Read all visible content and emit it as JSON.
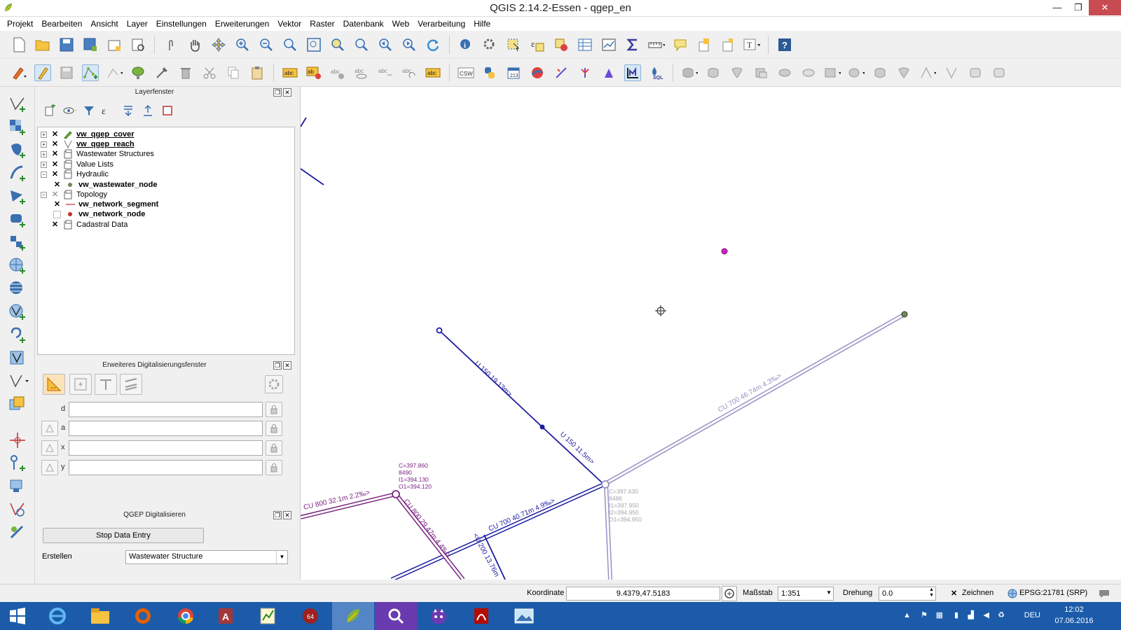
{
  "window": {
    "title": "QGIS 2.14.2-Essen - qgep_en",
    "minimize": "—",
    "restore": "❐",
    "close": "✕"
  },
  "menu": [
    "Projekt",
    "Bearbeiten",
    "Ansicht",
    "Layer",
    "Einstellungen",
    "Erweiterungen",
    "Vektor",
    "Raster",
    "Datenbank",
    "Web",
    "Verarbeitung",
    "Hilfe"
  ],
  "layers_panel": {
    "title": "Layerfenster",
    "layers": [
      {
        "name": "vw_qgep_cover",
        "checked": true,
        "expandable": true,
        "expanded": false,
        "bold": true,
        "icon": "pencil-icon"
      },
      {
        "name": "vw_qgep_reach",
        "checked": true,
        "expandable": true,
        "expanded": false,
        "bold": true,
        "icon": "line-icon"
      },
      {
        "name": "Wastewater Structures",
        "checked": true,
        "expandable": true,
        "expanded": false,
        "bold": false,
        "icon": "group-icon"
      },
      {
        "name": "Value Lists",
        "checked": true,
        "expandable": true,
        "expanded": false,
        "bold": false,
        "icon": "group-icon"
      },
      {
        "name": "Hydraulic",
        "checked": true,
        "expandable": true,
        "expanded": true,
        "bold": false,
        "icon": "group-icon"
      },
      {
        "name": "vw_wastewater_node",
        "checked": true,
        "expandable": false,
        "bold": true,
        "icon": "point-icon"
      },
      {
        "name": "Topology",
        "checked": "partial",
        "expandable": true,
        "expanded": true,
        "bold": false,
        "icon": "group-icon"
      },
      {
        "name": "vw_network_segment",
        "checked": true,
        "expandable": false,
        "bold": true,
        "icon": "red-line-icon"
      },
      {
        "name": "vw_network_node",
        "checked": false,
        "expandable": false,
        "bold": true,
        "icon": "red-point-icon"
      },
      {
        "name": "Cadastral Data",
        "checked": true,
        "expandable": false,
        "bold": false,
        "icon": "group-icon"
      }
    ]
  },
  "digitizing_panel": {
    "title": "Erweiteres Digitalisierungsfenster",
    "fields": [
      {
        "label": "d",
        "value": ""
      },
      {
        "label": "a",
        "value": ""
      },
      {
        "label": "x",
        "value": ""
      },
      {
        "label": "y",
        "value": ""
      }
    ]
  },
  "qgep_panel": {
    "title": "QGEP Digitalisieren",
    "stop_button": "Stop Data Entry",
    "create_label": "Erstellen",
    "create_value": "Wastewater Structure"
  },
  "map": {
    "labels": {
      "u150a": "U 150 19.13m>",
      "u150b": "U 150 11.5m>",
      "cu700a": "CU 700 46.74m 4.3‰>",
      "cu700b": "CU 700 40.71m 4.9‰>",
      "cu800a": "CU 800 32.1m 2.2‰>",
      "cu800b": "CU 800 29.47m 4.4‰>",
      "u200": "<U 200 13.76m"
    },
    "node1": [
      "C=397.860",
      "8490",
      "I1=394.130",
      "O1=394.120"
    ],
    "node2": [
      "C=397.630",
      "8486",
      "I1=397.950",
      "I2=394.950",
      "O1=394.950"
    ],
    "colors": {
      "blue": "#1c1ca0",
      "purple": "#7a2480",
      "lilac": "#9a8fc4",
      "magenta": "#d21ec8"
    }
  },
  "statusbar": {
    "coord_label": "Koordinate",
    "coord_value": "9.4379,47.5183",
    "scale_label": "Maßstab",
    "scale_value": "1:351",
    "rotation_label": "Drehung",
    "rotation_value": "0.0",
    "render_label": "Zeichnen",
    "crs": "EPSG:21781 (SRP)"
  },
  "taskbar": {
    "language": "DEU",
    "time": "12:02",
    "date": "07.06.2016"
  }
}
